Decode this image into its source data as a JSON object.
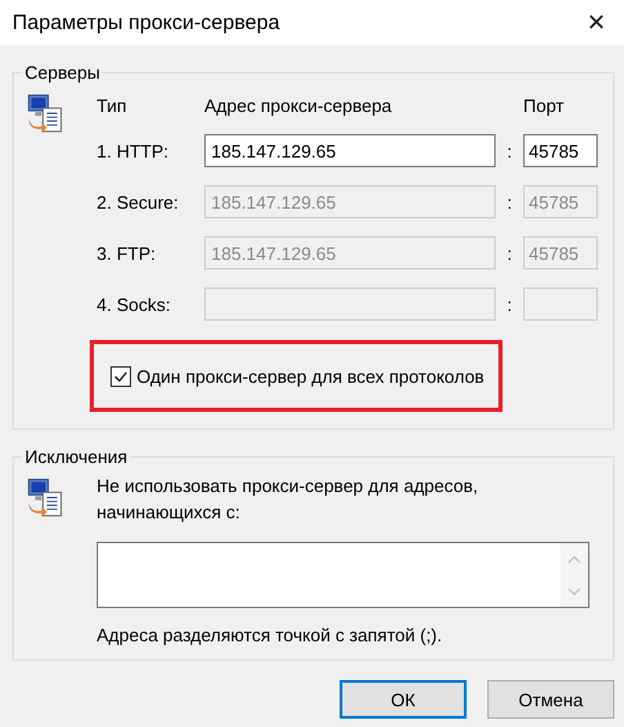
{
  "window": {
    "title": "Параметры прокси-сервера",
    "close": "✕"
  },
  "servers": {
    "legend": "Серверы",
    "headers": {
      "type": "Тип",
      "address": "Адрес прокси-сервера",
      "port": "Порт"
    },
    "rows": [
      {
        "label": "1. HTTP:",
        "address": "185.147.129.65",
        "separator": ":",
        "port": "45785",
        "disabled": false
      },
      {
        "label": "2. Secure:",
        "address": "185.147.129.65",
        "separator": ":",
        "port": "45785",
        "disabled": true
      },
      {
        "label": "3. FTP:",
        "address": "185.147.129.65",
        "separator": ":",
        "port": "45785",
        "disabled": true
      },
      {
        "label": "4. Socks:",
        "separator": ":",
        "disabled": true
      }
    ],
    "same_proxy": {
      "label": "Один прокси-сервер для всех протоколов",
      "checked": true,
      "highlighted": true
    }
  },
  "exceptions": {
    "legend": "Исключения",
    "description": "Не использовать прокси-сервер для адресов, начинающихся с:",
    "note": "Адреса разделяются точкой с запятой (;)."
  },
  "buttons": [
    {
      "label": "ОК",
      "default": true
    },
    {
      "label": "Отмена",
      "default": false
    }
  ]
}
